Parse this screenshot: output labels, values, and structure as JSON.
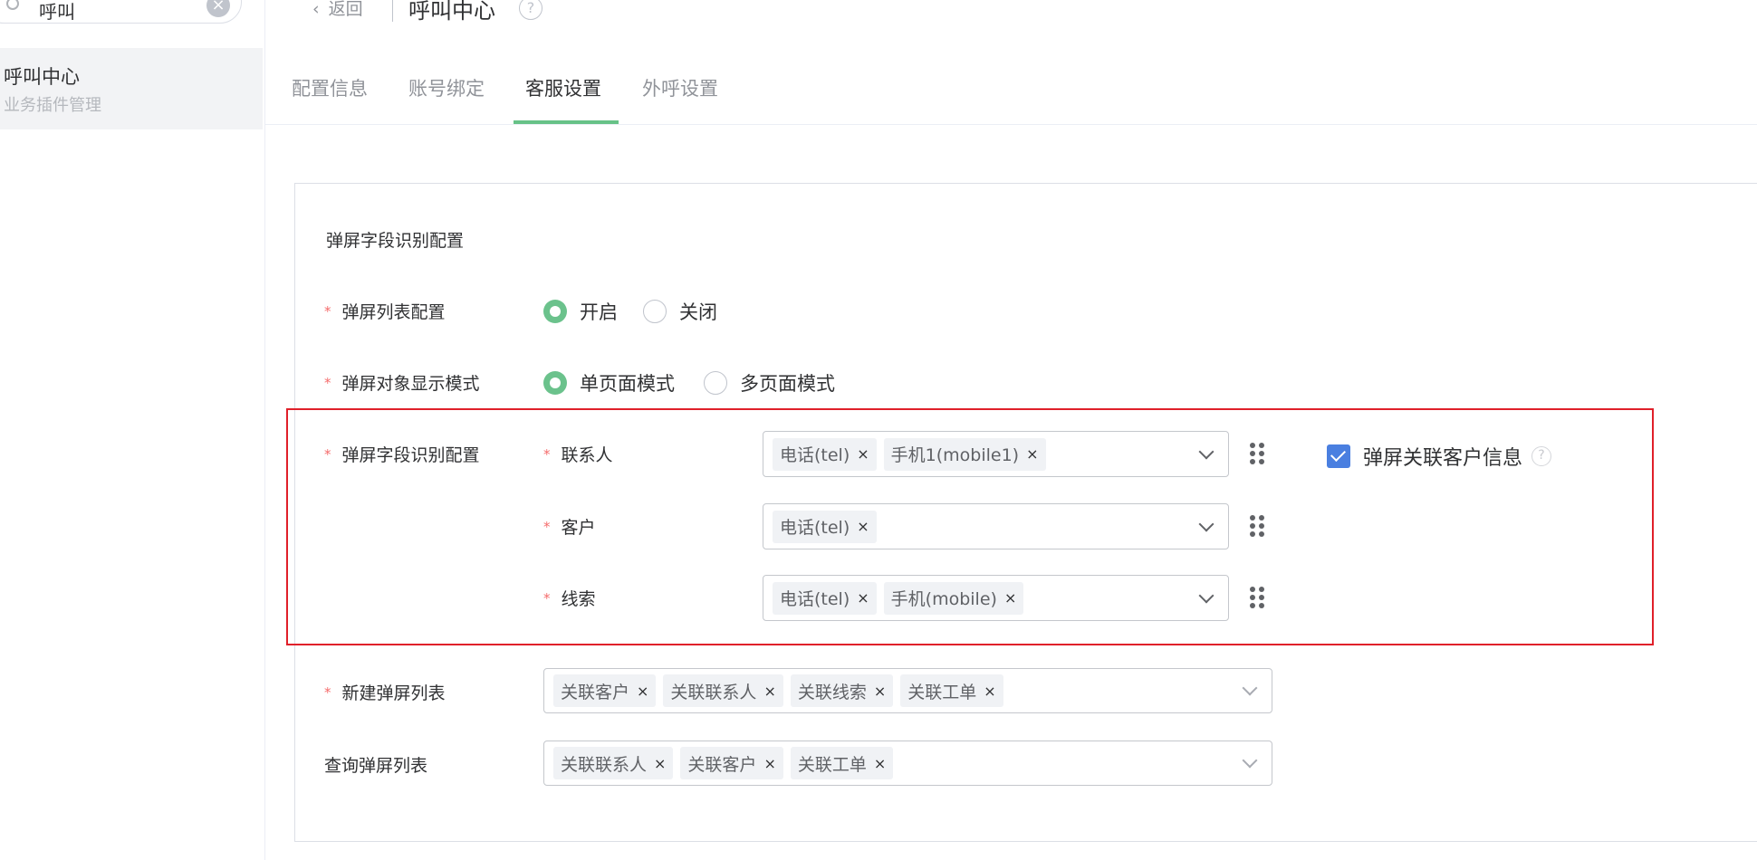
{
  "sidebar": {
    "search_value": "呼叫",
    "item": {
      "title": "呼叫中心",
      "subtitle": "业务插件管理"
    }
  },
  "header": {
    "back_label": "返回",
    "title": "呼叫中心"
  },
  "tabs": [
    {
      "label": "配置信息",
      "active": false
    },
    {
      "label": "账号绑定",
      "active": false
    },
    {
      "label": "客服设置",
      "active": true
    },
    {
      "label": "外呼设置",
      "active": false
    }
  ],
  "form": {
    "section_title": "弹屏字段识别配置",
    "popup_list": {
      "label": "弹屏列表配置",
      "options": [
        "开启",
        "关闭"
      ],
      "selected": "开启"
    },
    "display_mode": {
      "label": "弹屏对象显示模式",
      "options": [
        "单页面模式",
        "多页面模式"
      ],
      "selected": "单页面模式"
    },
    "field_recognition": {
      "label": "弹屏字段识别配置",
      "rows": [
        {
          "label": "联系人",
          "tags": [
            "电话(tel)",
            "手机1(mobile1)"
          ]
        },
        {
          "label": "客户",
          "tags": [
            "电话(tel)"
          ]
        },
        {
          "label": "线索",
          "tags": [
            "电话(tel)",
            "手机(mobile)"
          ]
        }
      ],
      "checkbox_label": "弹屏关联客户信息",
      "checkbox_checked": true
    },
    "new_popup_list": {
      "label": "新建弹屏列表",
      "tags": [
        "关联客户",
        "关联联系人",
        "关联线索",
        "关联工单"
      ]
    },
    "query_popup_list": {
      "label": "查询弹屏列表",
      "tags": [
        "关联联系人",
        "关联客户",
        "关联工单"
      ]
    }
  },
  "colors": {
    "accent": "#67c287",
    "highlight_border": "#e0202a",
    "checkbox": "#4a7fe0",
    "required": "#f56c6c"
  }
}
